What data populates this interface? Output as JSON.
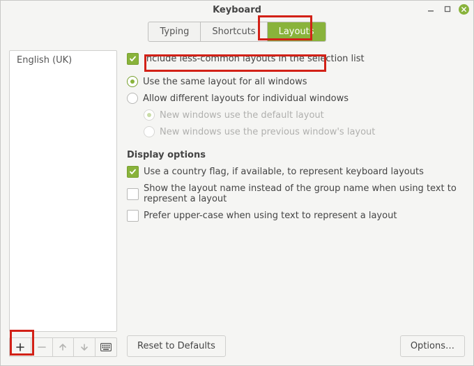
{
  "window": {
    "title": "Keyboard"
  },
  "tabs": {
    "typing": "Typing",
    "shortcuts": "Shortcuts",
    "layouts": "Layouts"
  },
  "layout_list": {
    "items": [
      "English (UK)"
    ]
  },
  "options": {
    "include_less_common": "Include less-common layouts in the selection list",
    "same_layout_all": "Use the same layout for all windows",
    "diff_layout_windows": "Allow different layouts for individual windows",
    "new_win_default": "New windows use the default layout",
    "new_win_previous": "New windows use the previous window's layout",
    "display_options_title": "Display options",
    "use_country_flag": "Use a country flag, if available,  to represent keyboard layouts",
    "show_layout_name": "Show the layout name instead of the group name when using text to represent a layout",
    "prefer_upper": "Prefer upper-case when using text to represent a layout"
  },
  "buttons": {
    "reset_defaults": "Reset to Defaults",
    "options": "Options…"
  }
}
